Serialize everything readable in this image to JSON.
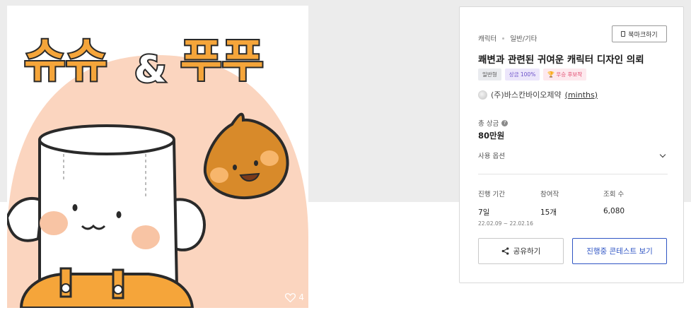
{
  "artwork": {
    "title_text": "슈슈&푸푸",
    "like_count": "4",
    "colors": {
      "backdrop": "#fbd5bf",
      "title_orange": "#f5a53a",
      "chestnut": "#d88a2a",
      "cheek": "#f8c4a4"
    }
  },
  "card": {
    "breadcrumb": [
      "캐릭터",
      "일반/기타"
    ],
    "bookmark_label": "북마크하기",
    "title": "쾌변과 관련된 귀여운 캐릭터 디자인 의뢰",
    "badges": {
      "general": "일반형",
      "prize": "상금 100%",
      "winner": "우승 후보작"
    },
    "host": {
      "name": "(주)바스칸바이오제약",
      "handle": "minths"
    },
    "prize": {
      "label": "총 상금",
      "value": "80만원"
    },
    "usage_label": "사용 옵션",
    "stats": {
      "period_label": "진행 기간",
      "period_value": "7일",
      "period_dates": "22.02.09 ~ 22.02.16",
      "entries_label": "참여작",
      "entries_value": "15개",
      "views_label": "조회 수",
      "views_value": "6,080"
    },
    "share_label": "공유하기",
    "browse_label": "진행중 콘테스트 보기",
    "accent_color": "#2f55c4"
  }
}
